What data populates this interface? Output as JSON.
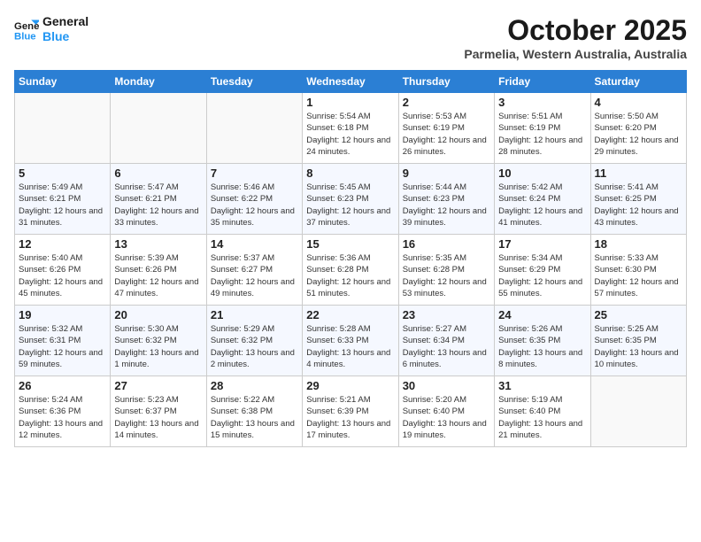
{
  "header": {
    "logo_line1": "General",
    "logo_line2": "Blue",
    "month": "October 2025",
    "location": "Parmelia, Western Australia, Australia"
  },
  "weekdays": [
    "Sunday",
    "Monday",
    "Tuesday",
    "Wednesday",
    "Thursday",
    "Friday",
    "Saturday"
  ],
  "weeks": [
    [
      {
        "day": "",
        "detail": ""
      },
      {
        "day": "",
        "detail": ""
      },
      {
        "day": "",
        "detail": ""
      },
      {
        "day": "1",
        "detail": "Sunrise: 5:54 AM\nSunset: 6:18 PM\nDaylight: 12 hours\nand 24 minutes."
      },
      {
        "day": "2",
        "detail": "Sunrise: 5:53 AM\nSunset: 6:19 PM\nDaylight: 12 hours\nand 26 minutes."
      },
      {
        "day": "3",
        "detail": "Sunrise: 5:51 AM\nSunset: 6:19 PM\nDaylight: 12 hours\nand 28 minutes."
      },
      {
        "day": "4",
        "detail": "Sunrise: 5:50 AM\nSunset: 6:20 PM\nDaylight: 12 hours\nand 29 minutes."
      }
    ],
    [
      {
        "day": "5",
        "detail": "Sunrise: 5:49 AM\nSunset: 6:21 PM\nDaylight: 12 hours\nand 31 minutes."
      },
      {
        "day": "6",
        "detail": "Sunrise: 5:47 AM\nSunset: 6:21 PM\nDaylight: 12 hours\nand 33 minutes."
      },
      {
        "day": "7",
        "detail": "Sunrise: 5:46 AM\nSunset: 6:22 PM\nDaylight: 12 hours\nand 35 minutes."
      },
      {
        "day": "8",
        "detail": "Sunrise: 5:45 AM\nSunset: 6:23 PM\nDaylight: 12 hours\nand 37 minutes."
      },
      {
        "day": "9",
        "detail": "Sunrise: 5:44 AM\nSunset: 6:23 PM\nDaylight: 12 hours\nand 39 minutes."
      },
      {
        "day": "10",
        "detail": "Sunrise: 5:42 AM\nSunset: 6:24 PM\nDaylight: 12 hours\nand 41 minutes."
      },
      {
        "day": "11",
        "detail": "Sunrise: 5:41 AM\nSunset: 6:25 PM\nDaylight: 12 hours\nand 43 minutes."
      }
    ],
    [
      {
        "day": "12",
        "detail": "Sunrise: 5:40 AM\nSunset: 6:26 PM\nDaylight: 12 hours\nand 45 minutes."
      },
      {
        "day": "13",
        "detail": "Sunrise: 5:39 AM\nSunset: 6:26 PM\nDaylight: 12 hours\nand 47 minutes."
      },
      {
        "day": "14",
        "detail": "Sunrise: 5:37 AM\nSunset: 6:27 PM\nDaylight: 12 hours\nand 49 minutes."
      },
      {
        "day": "15",
        "detail": "Sunrise: 5:36 AM\nSunset: 6:28 PM\nDaylight: 12 hours\nand 51 minutes."
      },
      {
        "day": "16",
        "detail": "Sunrise: 5:35 AM\nSunset: 6:28 PM\nDaylight: 12 hours\nand 53 minutes."
      },
      {
        "day": "17",
        "detail": "Sunrise: 5:34 AM\nSunset: 6:29 PM\nDaylight: 12 hours\nand 55 minutes."
      },
      {
        "day": "18",
        "detail": "Sunrise: 5:33 AM\nSunset: 6:30 PM\nDaylight: 12 hours\nand 57 minutes."
      }
    ],
    [
      {
        "day": "19",
        "detail": "Sunrise: 5:32 AM\nSunset: 6:31 PM\nDaylight: 12 hours\nand 59 minutes."
      },
      {
        "day": "20",
        "detail": "Sunrise: 5:30 AM\nSunset: 6:32 PM\nDaylight: 13 hours\nand 1 minute."
      },
      {
        "day": "21",
        "detail": "Sunrise: 5:29 AM\nSunset: 6:32 PM\nDaylight: 13 hours\nand 2 minutes."
      },
      {
        "day": "22",
        "detail": "Sunrise: 5:28 AM\nSunset: 6:33 PM\nDaylight: 13 hours\nand 4 minutes."
      },
      {
        "day": "23",
        "detail": "Sunrise: 5:27 AM\nSunset: 6:34 PM\nDaylight: 13 hours\nand 6 minutes."
      },
      {
        "day": "24",
        "detail": "Sunrise: 5:26 AM\nSunset: 6:35 PM\nDaylight: 13 hours\nand 8 minutes."
      },
      {
        "day": "25",
        "detail": "Sunrise: 5:25 AM\nSunset: 6:35 PM\nDaylight: 13 hours\nand 10 minutes."
      }
    ],
    [
      {
        "day": "26",
        "detail": "Sunrise: 5:24 AM\nSunset: 6:36 PM\nDaylight: 13 hours\nand 12 minutes."
      },
      {
        "day": "27",
        "detail": "Sunrise: 5:23 AM\nSunset: 6:37 PM\nDaylight: 13 hours\nand 14 minutes."
      },
      {
        "day": "28",
        "detail": "Sunrise: 5:22 AM\nSunset: 6:38 PM\nDaylight: 13 hours\nand 15 minutes."
      },
      {
        "day": "29",
        "detail": "Sunrise: 5:21 AM\nSunset: 6:39 PM\nDaylight: 13 hours\nand 17 minutes."
      },
      {
        "day": "30",
        "detail": "Sunrise: 5:20 AM\nSunset: 6:40 PM\nDaylight: 13 hours\nand 19 minutes."
      },
      {
        "day": "31",
        "detail": "Sunrise: 5:19 AM\nSunset: 6:40 PM\nDaylight: 13 hours\nand 21 minutes."
      },
      {
        "day": "",
        "detail": ""
      }
    ]
  ]
}
